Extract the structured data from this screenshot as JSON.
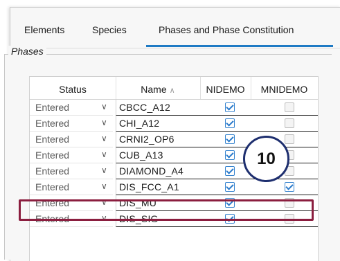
{
  "tabs": [
    {
      "label": "Elements"
    },
    {
      "label": "Species"
    },
    {
      "label": "Phases and Phase Constitution"
    }
  ],
  "group_title": "Phases",
  "columns": {
    "status": "Status",
    "name": "Name",
    "c1": "NIDEMO",
    "c2": "MNIDEMO"
  },
  "rows": [
    {
      "status": "Entered",
      "name": "CBCC_A12",
      "nidemo": true,
      "mnidemo": false
    },
    {
      "status": "Entered",
      "name": "CHI_A12",
      "nidemo": true,
      "mnidemo": false
    },
    {
      "status": "Entered",
      "name": "CRNI2_OP6",
      "nidemo": true,
      "mnidemo": false
    },
    {
      "status": "Entered",
      "name": "CUB_A13",
      "nidemo": true,
      "mnidemo": false
    },
    {
      "status": "Entered",
      "name": "DIAMOND_A4",
      "nidemo": true,
      "mnidemo": false
    },
    {
      "status": "Entered",
      "name": "DIS_FCC_A1",
      "nidemo": true,
      "mnidemo": true
    },
    {
      "status": "Entered",
      "name": "DIS_MU",
      "nidemo": true,
      "mnidemo": false
    },
    {
      "status": "Entered",
      "name": "DIS_SIG",
      "nidemo": true,
      "mnidemo": false
    }
  ],
  "callout_number": "10",
  "icons": {
    "sort": "sort-ascending-icon",
    "dropdown": "chevron-down-icon"
  },
  "colors": {
    "accent": "#1f7ac4",
    "highlight_border": "#8b1e3f",
    "callout_border": "#1e2f6f"
  }
}
